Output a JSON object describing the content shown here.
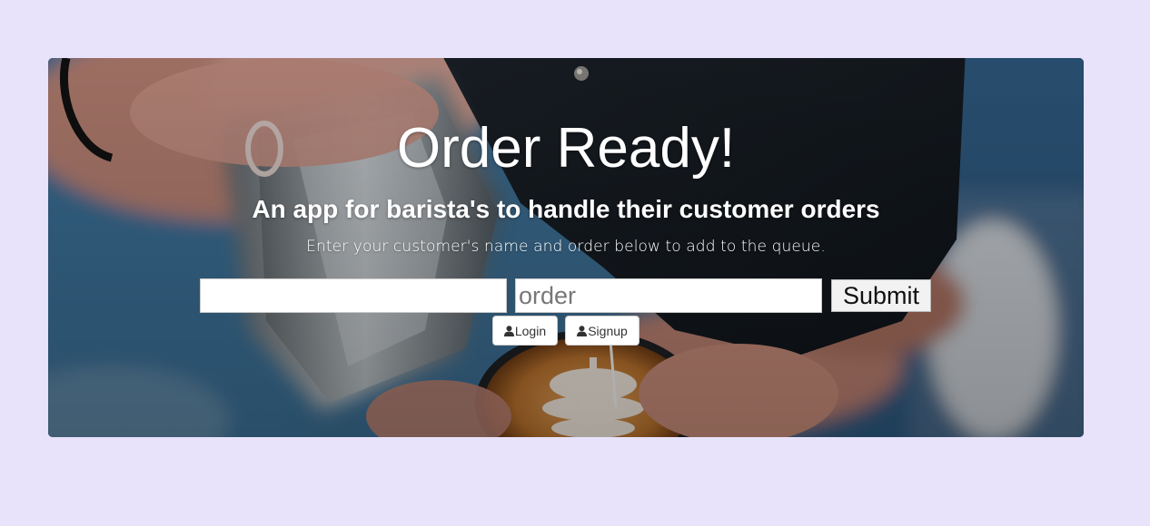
{
  "hero": {
    "title": "Order Ready!",
    "subtitle": "An app for barista's to handle their customer orders",
    "lead": "Enter your customer's name and order below to add to the queue."
  },
  "order_form": {
    "name_value": "",
    "name_placeholder": "",
    "order_value": "",
    "order_placeholder": "order",
    "submit_label": "Submit"
  },
  "auth": {
    "login_label": "Login",
    "signup_label": "Signup",
    "icon": "user-icon"
  },
  "colors": {
    "page_background": "#e8e2fb",
    "hero_text": "#ffffff",
    "button_text": "#333333"
  }
}
